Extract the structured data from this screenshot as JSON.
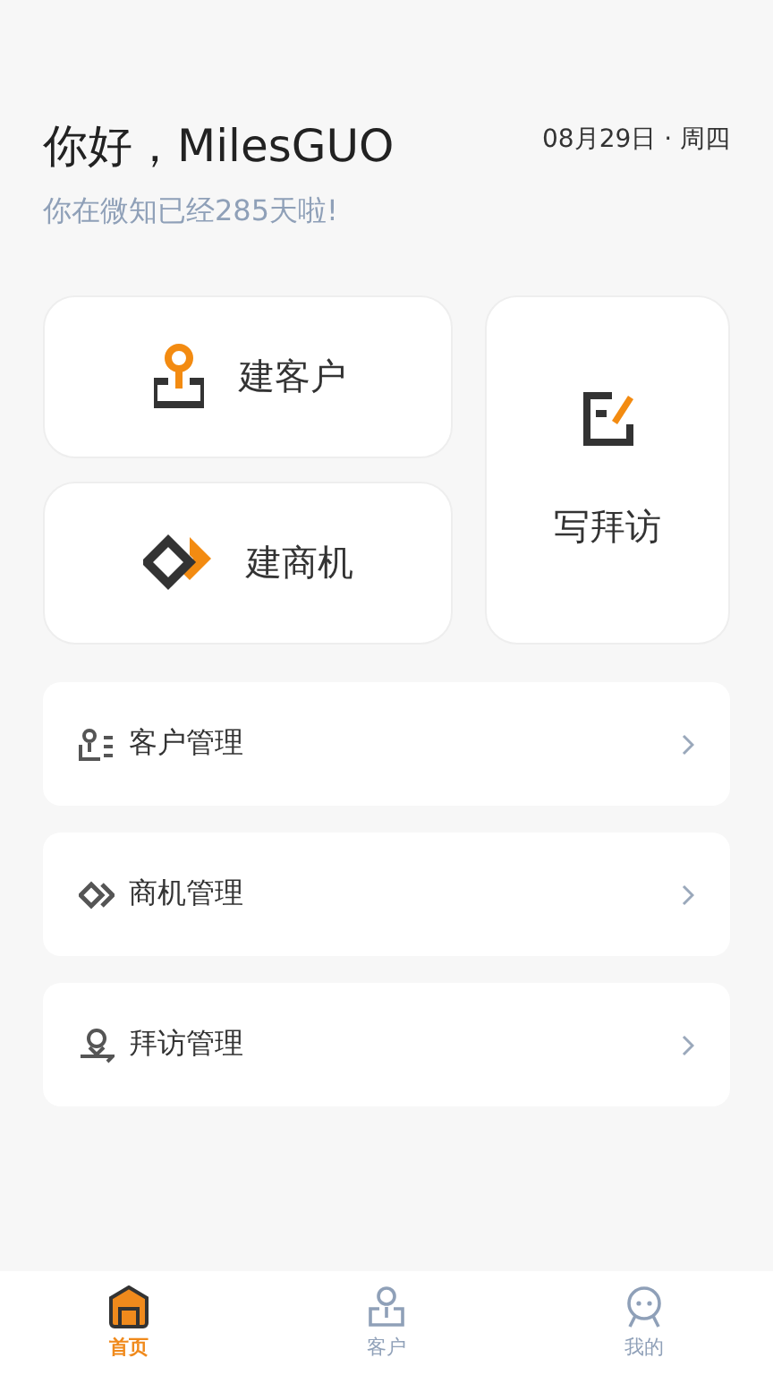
{
  "greeting": {
    "title": "你好，MilesGUO",
    "date": "08月29日 · 周四",
    "subtitle": "你在微知已经285天啦!"
  },
  "quick_actions": [
    {
      "kind": "customer",
      "label": "建客户"
    },
    {
      "kind": "opportunity",
      "label": "建商机"
    },
    {
      "kind": "visit",
      "label": "写拜访"
    }
  ],
  "menu": [
    {
      "kind": "customer",
      "label": "客户管理"
    },
    {
      "kind": "opportunity",
      "label": "商机管理"
    },
    {
      "kind": "visit",
      "label": "拜访管理"
    }
  ],
  "tab_bar": [
    {
      "kind": "home",
      "label": "首页",
      "selected": true
    },
    {
      "kind": "customer",
      "label": "客户",
      "selected": false
    },
    {
      "kind": "me",
      "label": "我的",
      "selected": false
    }
  ]
}
